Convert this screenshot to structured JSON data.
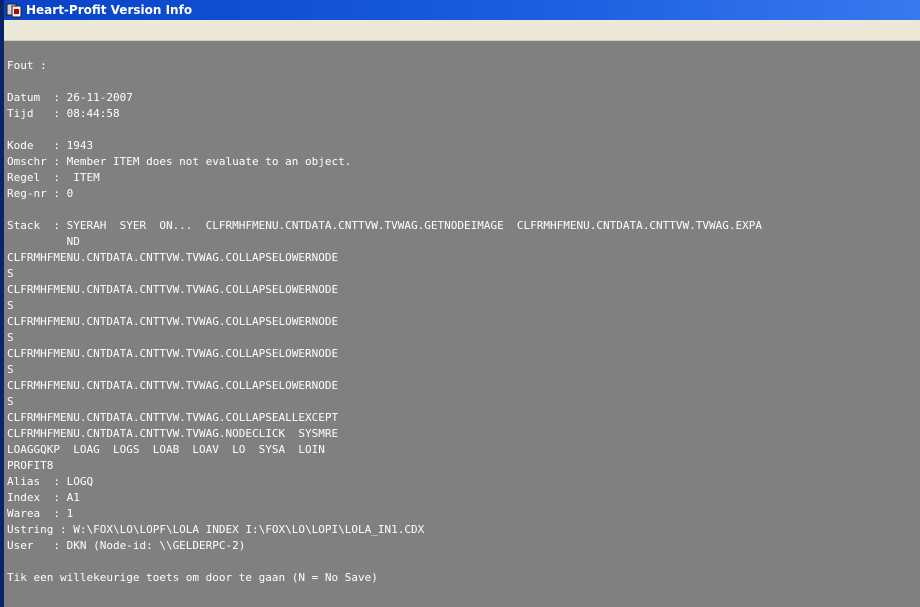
{
  "window": {
    "title": "Heart-Profit Version Info"
  },
  "icons": {
    "app": "app-icon"
  },
  "console": {
    "lines": [
      "Fout :",
      "",
      "Datum  : 26-11-2007",
      "Tijd   : 08:44:58",
      "",
      "Kode   : 1943",
      "Omschr : Member ITEM does not evaluate to an object.",
      "Regel  :  ITEM",
      "Reg-nr : 0",
      "",
      "Stack  : SYERAH  SYER  ON...  CLFRMHFMENU.CNTDATA.CNTTVW.TVWAG.GETNODEIMAGE  CLFRMHFMENU.CNTDATA.CNTTVW.TVWAG.EXPA",
      "         ND",
      "CLFRMHFMENU.CNTDATA.CNTTVW.TVWAG.COLLAPSELOWERNODE",
      "S",
      "CLFRMHFMENU.CNTDATA.CNTTVW.TVWAG.COLLAPSELOWERNODE",
      "S",
      "CLFRMHFMENU.CNTDATA.CNTTVW.TVWAG.COLLAPSELOWERNODE",
      "S",
      "CLFRMHFMENU.CNTDATA.CNTTVW.TVWAG.COLLAPSELOWERNODE",
      "S",
      "CLFRMHFMENU.CNTDATA.CNTTVW.TVWAG.COLLAPSELOWERNODE",
      "S",
      "CLFRMHFMENU.CNTDATA.CNTTVW.TVWAG.COLLAPSEALLEXCEPT",
      "CLFRMHFMENU.CNTDATA.CNTTVW.TVWAG.NODECLICK  SYSMRE",
      "LOAGGQKP  LOAG  LOGS  LOAB  LOAV  LO  SYSA  LOIN",
      "PROFIT8",
      "Alias  : LOGQ",
      "Index  : A1",
      "Warea  : 1",
      "Ustring : W:\\FOX\\LO\\LOPF\\LOLA INDEX I:\\FOX\\LO\\LOPI\\LOLA_IN1.CDX",
      "User   : DKN (Node-id: \\\\GELDERPC-2)",
      "",
      "Tik een willekeurige toets om door te gaan (N = No Save)"
    ]
  }
}
